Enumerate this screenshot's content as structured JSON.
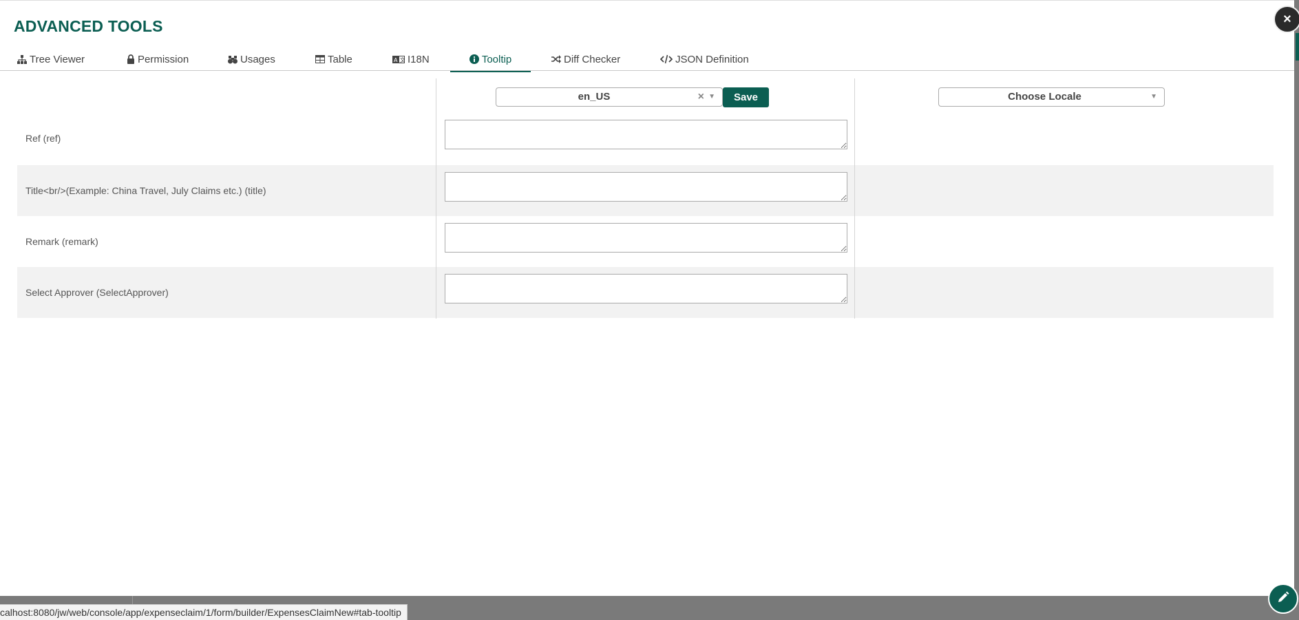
{
  "header": {
    "title": "ADVANCED TOOLS",
    "close_label": "×"
  },
  "tabs": [
    {
      "label": "Tree Viewer",
      "icon": "sitemap-icon"
    },
    {
      "label": "Permission",
      "icon": "lock-icon"
    },
    {
      "label": "Usages",
      "icon": "binoculars-icon"
    },
    {
      "label": "Table",
      "icon": "table-icon"
    },
    {
      "label": "I18N",
      "icon": "language-icon"
    },
    {
      "label": "Tooltip",
      "icon": "info-circle-icon",
      "active": true
    },
    {
      "label": "Diff Checker",
      "icon": "random-icon"
    },
    {
      "label": "JSON Definition",
      "icon": "code-icon"
    }
  ],
  "locale": {
    "selected": "en_US",
    "clear_symbol": "×",
    "arrow_symbol": "▼",
    "save_label": "Save",
    "compare_placeholder": "Choose Locale"
  },
  "rows": [
    {
      "label": "Ref (ref)",
      "value": ""
    },
    {
      "label": "Title<br/>(Example: China Travel, July Claims etc.) (title)",
      "value": ""
    },
    {
      "label": "Remark (remark)",
      "value": ""
    },
    {
      "label": "Select Approver (SelectApprover)",
      "value": ""
    }
  ],
  "status_bar": {
    "url": "calhost:8080/jw/web/console/app/expenseclaim/1/form/builder/ExpensesClaimNew#tab-tooltip"
  },
  "colors": {
    "accent": "#0b5e52",
    "row_shade": "#f2f2f2",
    "overlay": "#7a7a7a"
  }
}
